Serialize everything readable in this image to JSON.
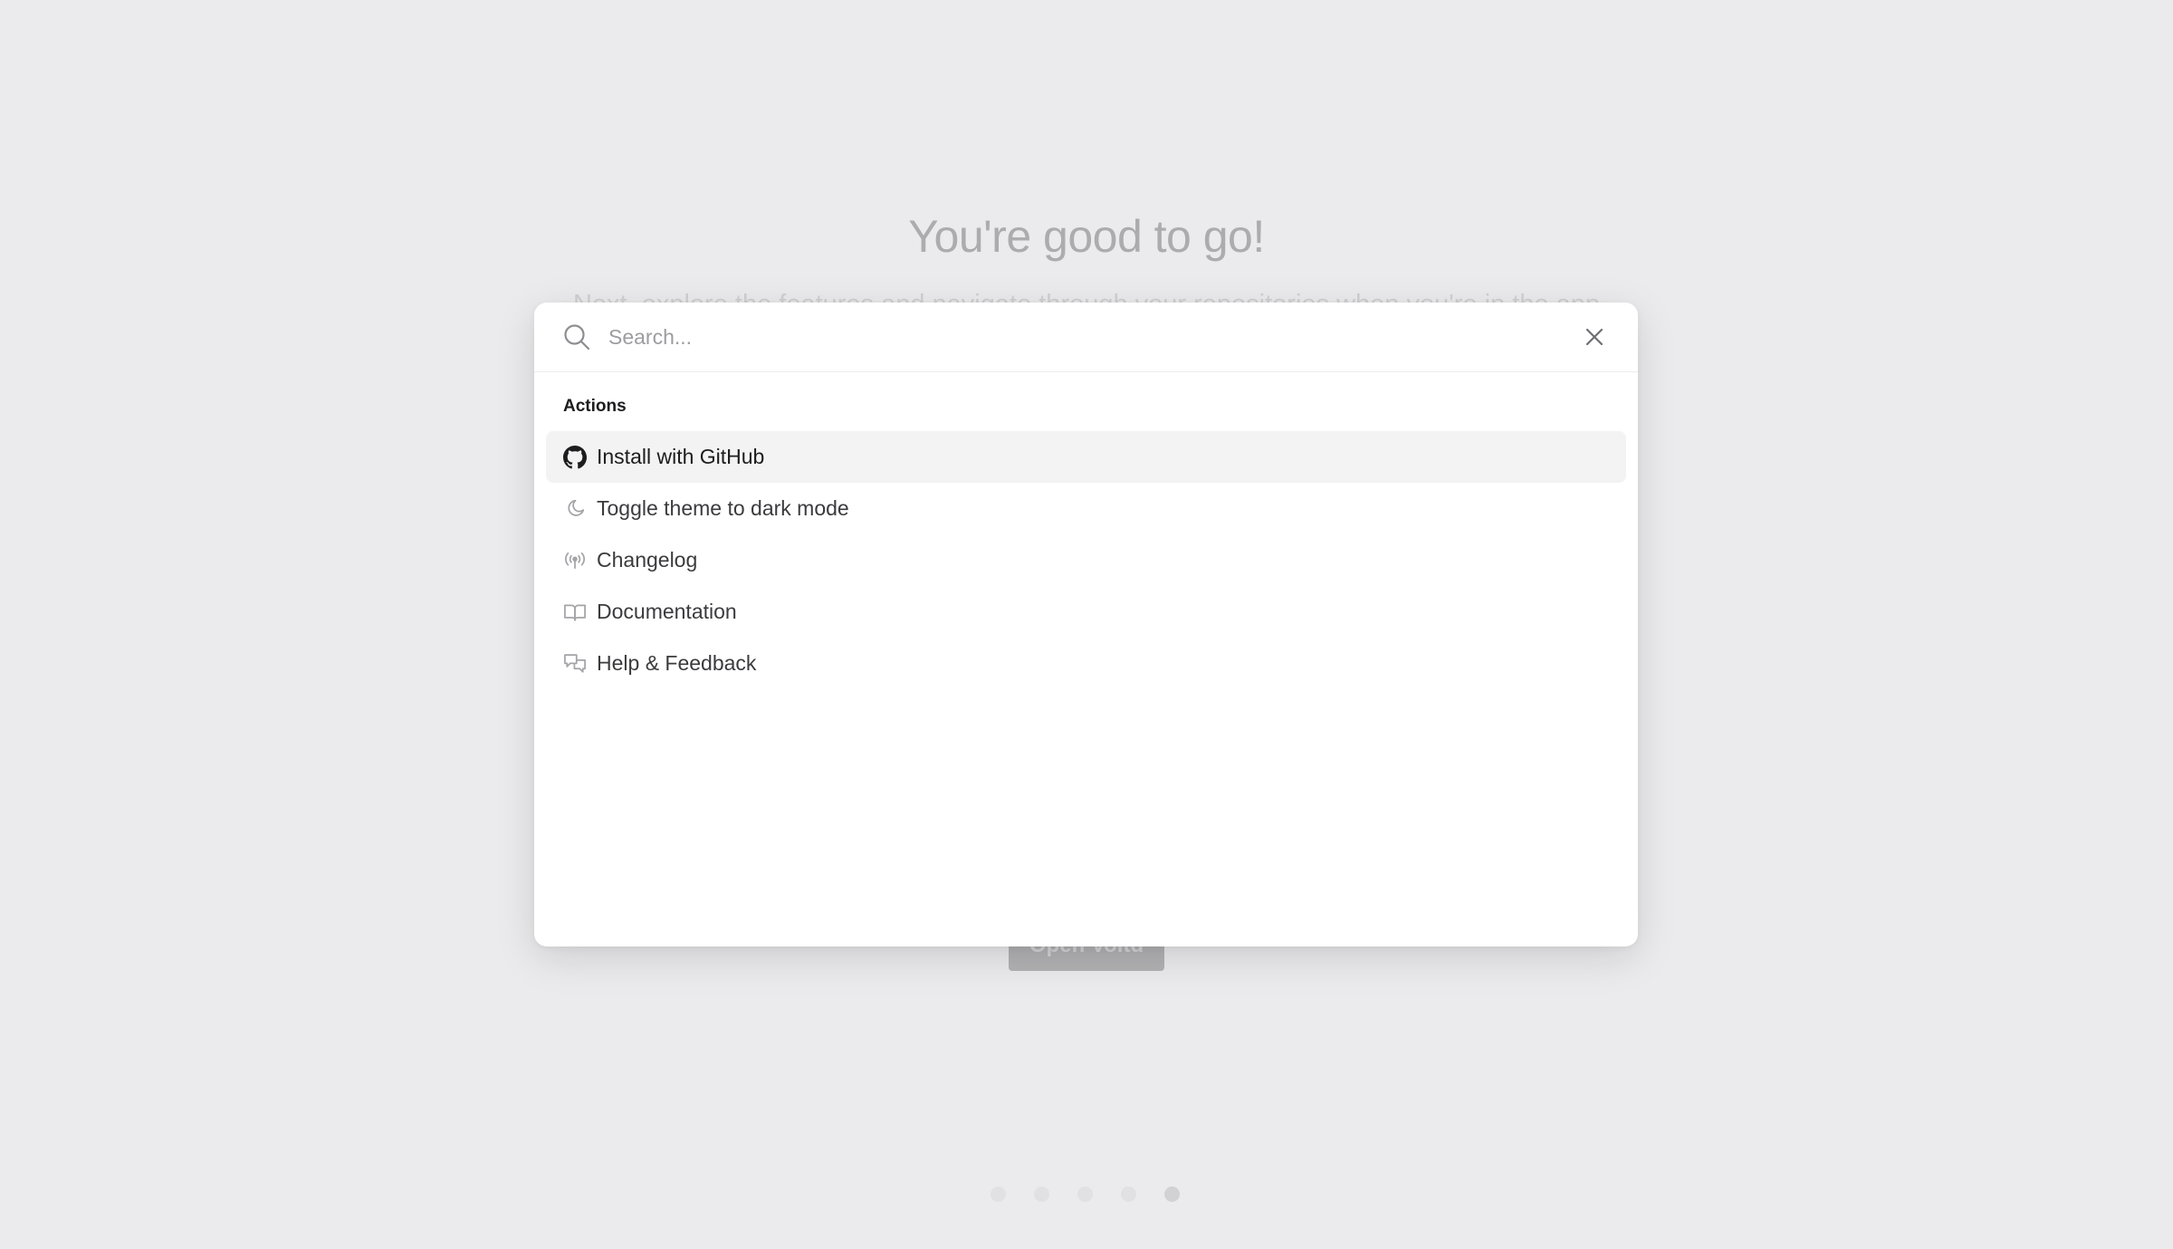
{
  "background": {
    "title": "You're good to go!",
    "subtitle": "Next, explore the features and navigate through your repositories when you're in the app",
    "button_label": "Open Voltd",
    "pagination": {
      "total": 5,
      "active": 5
    }
  },
  "palette": {
    "search": {
      "placeholder": "Search...",
      "value": ""
    },
    "section_label": "Actions",
    "items": [
      {
        "label": "Install with GitHub",
        "icon": "github-icon",
        "selected": true
      },
      {
        "label": "Toggle theme to dark mode",
        "icon": "moon-icon",
        "selected": false
      },
      {
        "label": "Changelog",
        "icon": "broadcast-icon",
        "selected": false
      },
      {
        "label": "Documentation",
        "icon": "book-icon",
        "selected": false
      },
      {
        "label": "Help & Feedback",
        "icon": "chat-bubbles-icon",
        "selected": false
      }
    ]
  },
  "colors": {
    "background": "#ebebed",
    "selected_row": "#f3f3f3",
    "icon_gray": "#a4a4a8"
  }
}
